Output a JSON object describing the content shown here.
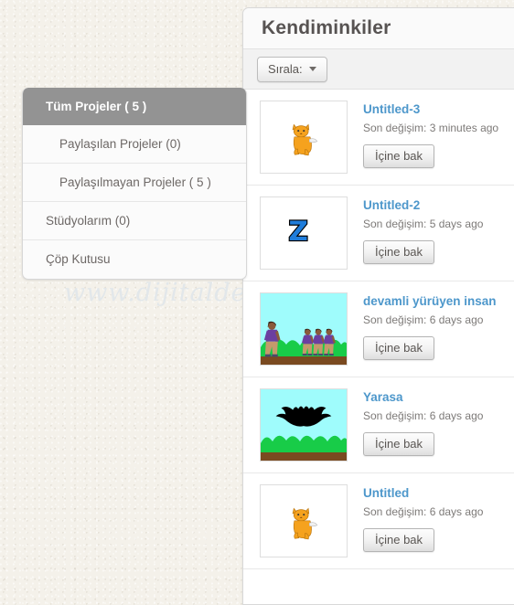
{
  "watermark": {
    "text": "www.dijitalders.com"
  },
  "sidebar": {
    "items": [
      {
        "label": "Tüm Projeler ( 5 )",
        "level": 0,
        "active": true,
        "name": "sidebar-item-all-projects"
      },
      {
        "label": "Paylaşılan Projeler (0)",
        "level": 1,
        "active": false,
        "name": "sidebar-item-shared-projects"
      },
      {
        "label": "Paylaşılmayan Projeler ( 5 )",
        "level": 1,
        "active": false,
        "name": "sidebar-item-unshared-projects"
      },
      {
        "label": "Stüdyolarım (0)",
        "level": 0,
        "active": false,
        "name": "sidebar-item-my-studios"
      },
      {
        "label": "Çöp Kutusu",
        "level": 0,
        "active": false,
        "name": "sidebar-item-trash"
      }
    ]
  },
  "content": {
    "title": "Kendiminkiler",
    "toolbar": {
      "sort_label": "Sırala:",
      "sort_icon": "chevron-down-icon"
    },
    "projects": [
      {
        "title": "Untitled-3",
        "meta": "Son değişim: 3 minutes ago",
        "button": "İçine bak",
        "thumb": "cat"
      },
      {
        "title": "Untitled-2",
        "meta": "Son değişim: 5 days ago",
        "button": "İçine bak",
        "thumb": "letter-z"
      },
      {
        "title": "devamli yürüyen insan",
        "meta": "Son değişim: 6 days ago",
        "button": "İçine bak",
        "thumb": "walkers"
      },
      {
        "title": "Yarasa",
        "meta": "Son değişim: 6 days ago",
        "button": "İçine bak",
        "thumb": "bat"
      },
      {
        "title": "Untitled",
        "meta": "Son değişim: 6 days ago",
        "button": "İçine bak",
        "thumb": "cat"
      }
    ]
  },
  "colors": {
    "page_bg": "#f4f1ea",
    "panel_bg": "#ffffff",
    "active_item_bg": "#939393",
    "link_blue": "#4d97cb",
    "title_text": "#575352",
    "meta_text": "#7d7a78",
    "sky": "#9ffcfc",
    "bush_green": "#18cc48",
    "ground_brown": "#7a4a20",
    "cat_orange": "#f5a21e",
    "letter_blue": "#1f7ddb"
  }
}
